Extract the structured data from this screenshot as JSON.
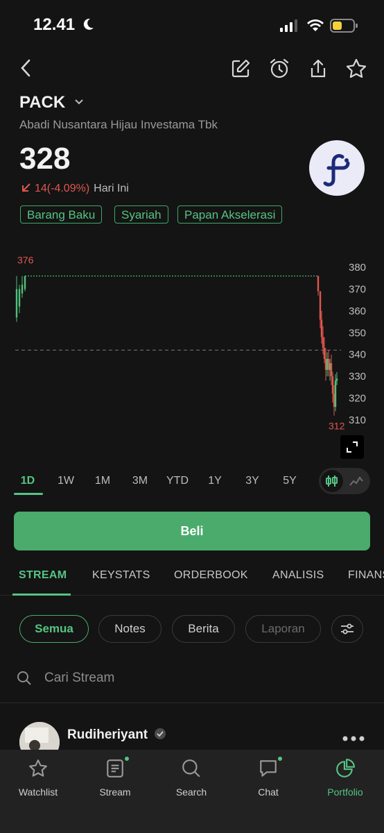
{
  "status": {
    "time": "12.41"
  },
  "header": {
    "back_icon": "chevron-left",
    "actions": [
      "edit-icon",
      "alarm-icon",
      "share-icon",
      "star-icon"
    ]
  },
  "stock": {
    "ticker": "PACK",
    "company": "Abadi Nusantara Hijau Investama Tbk",
    "price": "328",
    "change": "14(-4.09%)",
    "change_period": "Hari Ini",
    "tags": [
      "Barang Baku",
      "Syariah",
      "Papan Akselerasi"
    ]
  },
  "colors": {
    "accent": "#56c483",
    "down": "#e0574f",
    "up": "#4fc07a",
    "bg": "#141414"
  },
  "chart_data": {
    "type": "candlestick",
    "high_label": "376",
    "low_label": "312",
    "y_ticks": [
      "380",
      "370",
      "360",
      "350",
      "340",
      "330",
      "320",
      "310"
    ],
    "ylim": [
      310,
      380
    ],
    "previous_close": 342,
    "candles": [
      {
        "o": 357,
        "h": 376,
        "l": 355,
        "c": 370
      },
      {
        "o": 362,
        "h": 372,
        "l": 359,
        "c": 370
      },
      {
        "o": 368,
        "h": 376,
        "l": 366,
        "c": 372
      },
      {
        "o": 370,
        "h": 376,
        "l": 369,
        "c": 376
      },
      {
        "o": 376,
        "h": 376,
        "l": 367,
        "c": 369
      },
      {
        "o": 369,
        "h": 369,
        "l": 352,
        "c": 356
      },
      {
        "o": 356,
        "h": 360,
        "l": 345,
        "c": 348
      },
      {
        "o": 348,
        "h": 353,
        "l": 340,
        "c": 343
      },
      {
        "o": 343,
        "h": 348,
        "l": 336,
        "c": 338
      },
      {
        "o": 338,
        "h": 343,
        "l": 328,
        "c": 333
      },
      {
        "o": 333,
        "h": 341,
        "l": 330,
        "c": 338
      },
      {
        "o": 338,
        "h": 342,
        "l": 330,
        "c": 333
      },
      {
        "o": 333,
        "h": 338,
        "l": 328,
        "c": 336
      },
      {
        "o": 336,
        "h": 340,
        "l": 326,
        "c": 330
      },
      {
        "o": 330,
        "h": 332,
        "l": 318,
        "c": 322
      },
      {
        "o": 322,
        "h": 326,
        "l": 312,
        "c": 316
      },
      {
        "o": 316,
        "h": 331,
        "l": 314,
        "c": 328
      },
      {
        "o": 328,
        "h": 332,
        "l": 326,
        "c": 329
      }
    ]
  },
  "ranges": {
    "items": [
      "1D",
      "1W",
      "1M",
      "3M",
      "YTD",
      "1Y",
      "3Y",
      "5Y"
    ],
    "selected": "1D"
  },
  "buy_label": "Beli",
  "tabs": {
    "items": [
      "STREAM",
      "KEYSTATS",
      "ORDERBOOK",
      "ANALISIS",
      "FINANS"
    ],
    "selected": "STREAM"
  },
  "filters": {
    "items": [
      "Semua",
      "Notes",
      "Berita",
      "Laporan"
    ],
    "selected": "Semua",
    "disabled": "Laporan"
  },
  "search": {
    "placeholder": "Cari Stream"
  },
  "post": {
    "username": "Rudiheriyant"
  },
  "bottom_nav": {
    "items": [
      {
        "label": "Watchlist",
        "icon": "star-icon",
        "badge": false
      },
      {
        "label": "Stream",
        "icon": "stream-icon",
        "badge": true
      },
      {
        "label": "Search",
        "icon": "search-icon",
        "badge": false
      },
      {
        "label": "Chat",
        "icon": "chat-icon",
        "badge": true
      },
      {
        "label": "Portfolio",
        "icon": "portfolio-icon",
        "badge": false
      }
    ],
    "selected": "Portfolio"
  }
}
